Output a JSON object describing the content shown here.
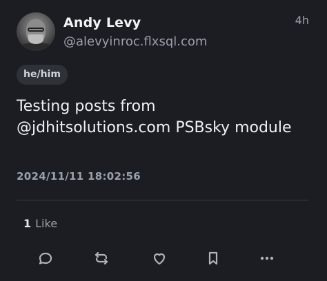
{
  "post": {
    "display_name": "Andy Levy",
    "handle": "@alevyinroc.flxsql.com",
    "time_ago": "4h",
    "pronouns": "he/him",
    "text": "Testing posts from @jdhitsolutions.com PSBsky module",
    "timestamp": "2024/11/11 18:02:56"
  },
  "stats": {
    "like_count": "1",
    "like_label": "Like"
  },
  "actions": [
    "reply-icon",
    "repost-icon",
    "like-icon",
    "bookmark-icon",
    "more-icon"
  ]
}
